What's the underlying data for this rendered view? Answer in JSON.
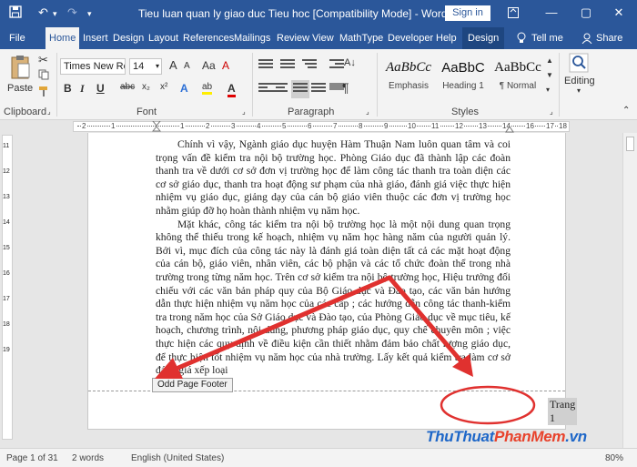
{
  "window": {
    "title": "Tieu luan quan ly giao duc Tieu hoc [Compatibility Mode]  -  Word",
    "sign_in": "Sign in",
    "minimize_glyph": "—",
    "restore_glyph": "▢",
    "close_glyph": "✕"
  },
  "quick_access": {
    "save_icon": "save-icon",
    "undo_icon": "undo-icon",
    "redo_icon": "redo-icon",
    "customize_icon": "customize-icon"
  },
  "tabs": [
    "File",
    "Home",
    "Insert",
    "Design",
    "Layout",
    "References",
    "Mailings",
    "Review",
    "View",
    "MathType",
    "Developer",
    "Help"
  ],
  "active_tab": "Home",
  "contextual_tab": "Design",
  "tell_me": "Tell me",
  "share": "Share",
  "ribbon": {
    "clipboard": {
      "label": "Clipboard",
      "paste": "Paste"
    },
    "font": {
      "label": "Font",
      "font_name": "Times New Ro",
      "font_size": "14",
      "grow": "A",
      "shrink": "A",
      "change_case": "Aa",
      "clear": "A",
      "bold": "B",
      "italic": "I",
      "underline": "U",
      "strike": "abc",
      "subscript": "x₂",
      "superscript": "x²",
      "text_effects": "A",
      "highlight": "ab",
      "font_color": "A"
    },
    "paragraph": {
      "label": "Paragraph",
      "pilcrow": "¶",
      "sort": "A↓"
    },
    "styles": {
      "label": "Styles",
      "items": [
        {
          "sample": "AaBbCc",
          "name": "Emphasis"
        },
        {
          "sample": "AaBbC",
          "name": "Heading 1"
        },
        {
          "sample": "AaBbCc",
          "name": "¶ Normal"
        }
      ]
    },
    "editing": {
      "label": "Editing"
    }
  },
  "ruler_numbers": [
    "2",
    "1",
    "1",
    "2",
    "3",
    "4",
    "5",
    "6",
    "7",
    "8",
    "9",
    "10",
    "11",
    "12",
    "13",
    "14",
    "16",
    "17",
    "18"
  ],
  "vertical_ruler_numbers": [
    "11",
    "12",
    "13",
    "14",
    "15",
    "16",
    "17",
    "18",
    "19"
  ],
  "document": {
    "paragraphs": [
      "Chính vì vậy, Ngành giáo dục huyện Hàm Thuận Nam luôn quan tâm và coi trọng vấn đề kiểm tra nội bộ trường học. Phòng Giáo dục đã thành lập các đoàn thanh tra về dưới cơ sở đơn vị trường học để làm công tác thanh tra toàn diện các cơ sở giáo dục, thanh tra hoạt động sư phạm của nhà giáo, đánh giá việc thực hiện nhiệm vụ giáo dục, giảng dạy của cán bộ giáo viên thuộc các đơn vị trường học nhằm giúp đỡ họ hoàn thành nhiệm vụ năm học.",
      "Mặt khác, công tác kiểm tra nội bộ trường học là một nội dung quan trọng không thể thiếu trong kế hoạch, nhiệm vụ năm học hàng năm của người quản lý. Bởi vì, mục đích của công tác này là đánh giá toàn diện tất cả các mặt hoạt động của cán bộ, giáo viên, nhân viên, các bộ phận và các tổ chức đoàn thể trong nhà trường trong từng năm học. Trên cơ sở kiểm tra nội bộ trường học, Hiệu trưởng đối chiếu với các văn bản pháp quy của Bộ Giáo dục và Đào tạo, các văn bản hướng dẫn thực hiện nhiệm vụ năm học của các cấp ; các hướng dẫn công tác thanh-kiểm tra trong năm học của Sở Giáo dục và Đào tạo, của Phòng Giáo dục về mục tiêu, kế hoạch, chương trình, nội dung, phương pháp giáo dục, quy chế chuyên môn ; việc thực hiện các quy định về điều kiện cần thiết nhằm đảm bảo chất lượng giáo dục, để thực hiện tốt nhiệm vụ năm học của nhà trường. Lấy kết quả kiểm tra làm cơ sở đánh giá xếp loại"
    ],
    "footer_label": "Odd Page Footer",
    "page_number": "Trang 1"
  },
  "status": {
    "page": "Page 1 of 31",
    "words": "2 words",
    "language": "English (United States)",
    "zoom": "80%"
  },
  "watermark": {
    "part1": "ThuThuat",
    "part2": "PhanMem",
    "part3": ".vn"
  },
  "colors": {
    "accent": "#2b579a",
    "annotation_red": "#e0312f",
    "wm_blue": "#1e67c8",
    "wm_red": "#e8432c"
  }
}
